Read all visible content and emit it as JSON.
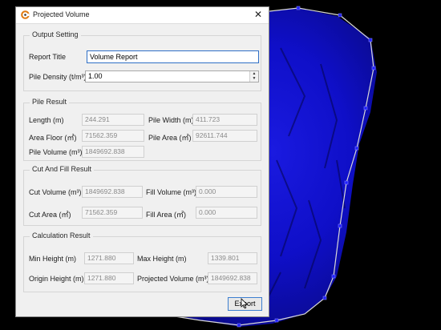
{
  "dialog": {
    "title": "Projected Volume",
    "close_glyph": "✕"
  },
  "output_setting": {
    "group_title": "Output Setting",
    "report_title_label": "Report Title",
    "report_title_value": "Volume Report",
    "pile_density_label": "Pile Density (t/m³)",
    "pile_density_value": "1.00"
  },
  "pile_result": {
    "group_title": "Pile Result",
    "length_label": "Length (m)",
    "length_value": "244.291",
    "width_label": "Pile Width (m)",
    "width_value": "411.723",
    "area_floor_label": "Area Floor (㎡)",
    "area_floor_value": "71562.359",
    "pile_area_label": "Pile Area (㎡)",
    "pile_area_value": "92611.744",
    "pile_volume_label": "Pile Volume (m³)",
    "pile_volume_value": "1849692.838"
  },
  "cut_fill": {
    "group_title": "Cut And Fill Result",
    "cut_volume_label": "Cut Volume (m³)",
    "cut_volume_value": "1849692.838",
    "fill_volume_label": "Fill Volume (m³)",
    "fill_volume_value": "0.000",
    "cut_area_label": "Cut Area (㎡)",
    "cut_area_value": "71562.359",
    "fill_area_label": "Fill Area (㎡)",
    "fill_area_value": "0.000"
  },
  "calculation": {
    "group_title": "Calculation Result",
    "min_height_label": "Min Height (m)",
    "min_height_value": "1271.880",
    "max_height_label": "Max Height (m)",
    "max_height_value": "1339.801",
    "origin_height_label": "Origin Height (m)",
    "origin_height_value": "1271.880",
    "projected_volume_label": "Projected Volume (m³)",
    "projected_volume_value": "1849692.838"
  },
  "buttons": {
    "export_label": "Export"
  },
  "icons": {
    "app": "app-logo-icon",
    "close": "close-icon",
    "spin": "spin-arrows-icon",
    "cursor": "mouse-pointer-icon"
  },
  "colors": {
    "point_cloud": "#1010d8",
    "polygon_outline": "#d8d8d8",
    "vertex_marker": "#2020ff",
    "accent_border": "#2f6fc6",
    "app_icon": "#e07a10"
  }
}
